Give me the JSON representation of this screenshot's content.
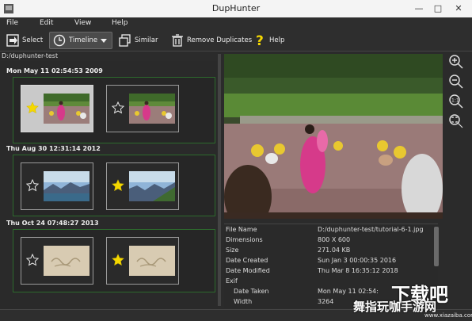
{
  "window": {
    "title": "DupHunter"
  },
  "menu": [
    "File",
    "Edit",
    "View",
    "Help"
  ],
  "toolbar": {
    "select": "Select",
    "timeline": "Timeline",
    "similar": "Similar",
    "remove_duplicates": "Remove Duplicates",
    "help": "Help"
  },
  "path": "D:/duphunter-test",
  "groups": [
    {
      "date": "Mon May 11 02:54:53 2009",
      "thumbs": [
        {
          "starred": true,
          "selected": true,
          "image": "dance-scene"
        },
        {
          "starred": false,
          "selected": false,
          "image": "dance-scene"
        }
      ]
    },
    {
      "date": "Thu Aug 30 12:31:14 2012",
      "thumbs": [
        {
          "starred": false,
          "selected": false,
          "image": "mountain-lake"
        },
        {
          "starred": true,
          "selected": false,
          "image": "mountain-lake"
        }
      ]
    },
    {
      "date": "Thu Oct 24 07:48:27 2013",
      "thumbs": [
        {
          "starred": false,
          "selected": false,
          "image": "sand-writing"
        },
        {
          "starred": true,
          "selected": false,
          "image": "sand-writing"
        }
      ]
    }
  ],
  "zoom_icons": [
    "zoom-in-icon",
    "zoom-out-icon",
    "zoom-actual-icon",
    "zoom-fit-icon"
  ],
  "properties": [
    {
      "key": "File Name",
      "value": "D:/duphunter-test/tutorial-6-1.jpg"
    },
    {
      "key": "Dimensions",
      "value": "800 X 600"
    },
    {
      "key": "Size",
      "value": "271.04 KB"
    },
    {
      "key": "Date Created",
      "value": "Sun Jan 3 00:00:35 2016"
    },
    {
      "key": "Date Modified",
      "value": "Thu Mar 8 16:35:12 2018"
    },
    {
      "key": "Exif",
      "value": ""
    },
    {
      "key": "Date Taken",
      "value": "Mon May 11 02:54:"
    },
    {
      "key": "Width",
      "value": "3264"
    }
  ],
  "watermark": {
    "big": "下载吧",
    "cn": "舞指玩咖手游网",
    "url": "www.xiazaiba.com"
  },
  "colors": {
    "accent_green": "#2d6a2d",
    "star_yellow": "#f5d800",
    "background": "#2b2b2b"
  }
}
